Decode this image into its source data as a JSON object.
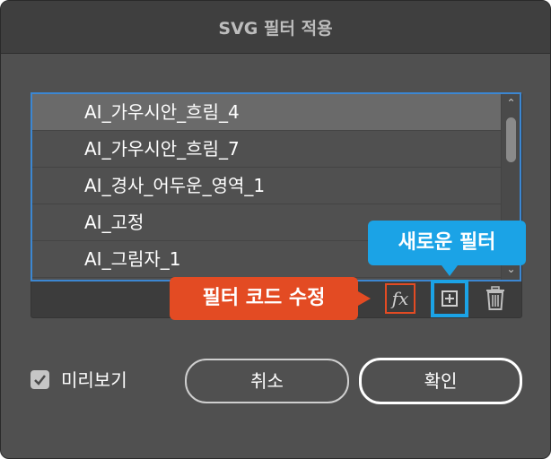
{
  "dialog": {
    "title": "SVG 필터 적용"
  },
  "filter_list": {
    "items": [
      {
        "label": "AI_가우시안_흐림_4",
        "selected": true
      },
      {
        "label": "AI_가우시안_흐림_7",
        "selected": false
      },
      {
        "label": "AI_경사_어두운_영역_1",
        "selected": false
      },
      {
        "label": "AI_고정",
        "selected": false
      },
      {
        "label": "AI_그림자_1",
        "selected": false
      }
    ]
  },
  "toolbar": {
    "fx_label": "fx",
    "fx_icon": "fx-icon",
    "new_icon": "plus-square-icon",
    "delete_icon": "trash-icon"
  },
  "callouts": {
    "edit_filter_code": "필터 코드 수정",
    "new_filter": "새로운 필터"
  },
  "preview": {
    "label": "미리보기",
    "checked": true
  },
  "buttons": {
    "cancel": "취소",
    "ok": "확인"
  },
  "colors": {
    "selection_border": "#3c87d2",
    "callout_red": "#e34b23",
    "callout_blue": "#1ba3e6"
  }
}
